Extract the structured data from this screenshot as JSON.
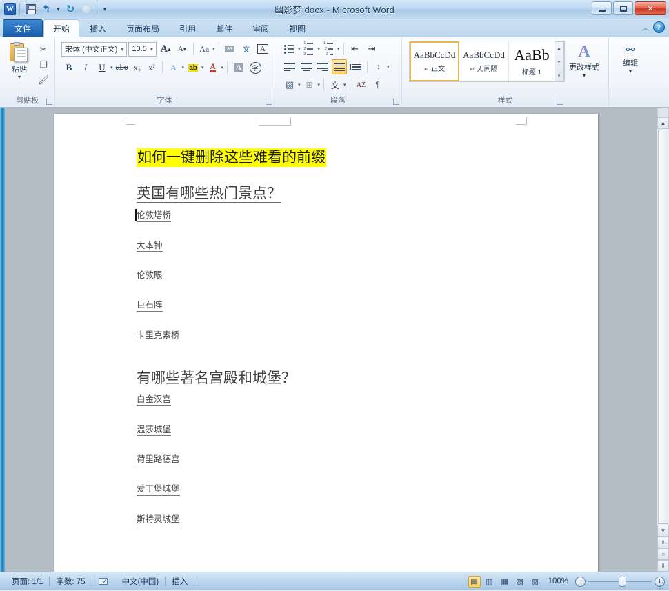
{
  "window": {
    "title": "幽影梦.docx - Microsoft Word",
    "minimize_label": "最小化",
    "restore_label": "还原",
    "close_label": "✕"
  },
  "quick_access": {
    "app_logo": "W",
    "items": [
      {
        "name": "save-icon",
        "label": "保存"
      },
      {
        "name": "undo-icon",
        "label": "撤消"
      },
      {
        "name": "undo-dropdown-icon",
        "label": "▾"
      },
      {
        "name": "redo-icon",
        "label": "恢复"
      },
      {
        "name": "print-preview-icon",
        "label": "打印预览"
      },
      {
        "name": "customize-qat-icon",
        "label": "▾"
      }
    ]
  },
  "tabs": [
    {
      "id": "file",
      "label": "文件"
    },
    {
      "id": "home",
      "label": "开始"
    },
    {
      "id": "insert",
      "label": "插入"
    },
    {
      "id": "layout",
      "label": "页面布局"
    },
    {
      "id": "references",
      "label": "引用"
    },
    {
      "id": "mailings",
      "label": "邮件"
    },
    {
      "id": "review",
      "label": "审阅"
    },
    {
      "id": "view",
      "label": "视图"
    }
  ],
  "ribbon_right": {
    "collapse_label": "︿",
    "help_label": "?"
  },
  "groups": {
    "clipboard": {
      "label": "剪贴板",
      "paste_label": "粘贴",
      "paste_caret": "▾",
      "cut_label": "✂",
      "copy_label": "❐",
      "format_painter_label": "🖌"
    },
    "font": {
      "label": "字体",
      "font_name": "宋体 (中文正文)",
      "font_size": "10.5",
      "grow_font": "A",
      "shrink_font": "A",
      "change_case": "Aa",
      "phonetic_guide": "Aa",
      "character_border": "文",
      "clear_formatting": "A",
      "bold": "B",
      "italic": "I",
      "underline": "U",
      "strikethrough": "abc",
      "subscript": "x₂",
      "superscript": "x²",
      "text_effects": "A",
      "highlight": "ab",
      "font_color": "A",
      "shading": "A",
      "enclose_char": "字",
      "dropdown": "▾"
    },
    "paragraph": {
      "label": "段落",
      "bullets": "•",
      "numbering": "1.",
      "multilevel": "⁝",
      "decrease_indent": "⇤",
      "increase_indent": "⇥",
      "align_left": "≡",
      "align_center": "≡",
      "align_right": "≡",
      "justify": "≡",
      "distributed": "≣",
      "line_spacing": "↕",
      "shading": "▨",
      "borders": "⊞",
      "asian_layout": "文",
      "sort": "AZ",
      "show_marks": "¶",
      "dropdown": "▾"
    },
    "styles": {
      "label": "样式",
      "items": [
        {
          "sample": "AaBbCcDd",
          "name": "正文",
          "pilcrow": "↵",
          "selected": true
        },
        {
          "sample": "AaBbCcDd",
          "name": "无间隔",
          "pilcrow": "↵",
          "selected": false
        },
        {
          "sample": "AaBb",
          "name": "标题 1",
          "pilcrow": "",
          "selected": false
        }
      ],
      "scroll_up": "▲",
      "scroll_down": "▼",
      "more": "▾",
      "change_styles_label": "更改样式",
      "change_styles_caret": "▾"
    },
    "editing": {
      "label": "编辑",
      "button_label": "编辑",
      "caret": "▾",
      "icon": "🔍"
    }
  },
  "document": {
    "title": "如何一键删除这些难看的前缀",
    "title_highlight_color": "#ffff00",
    "sections": [
      {
        "heading": "英国有哪些热门景点？",
        "heading_underlined": true,
        "items": [
          "伦敦塔桥",
          "大本钟",
          "伦敦眼",
          "巨石阵",
          "卡里克索桥"
        ]
      },
      {
        "heading": "有哪些著名宫殿和城堡？",
        "heading_underlined": false,
        "items": [
          "白金汉宫",
          "温莎城堡",
          "荷里路德宫",
          "爱丁堡城堡",
          "斯特灵城堡"
        ]
      }
    ]
  },
  "scrollbar": {
    "up_arrow": "▲",
    "down_arrow": "▼",
    "prev_page": "⬆",
    "select_browse_object": "○",
    "next_page": "⬇",
    "split_handle": "▭"
  },
  "statusbar": {
    "page_info": "页面: 1/1",
    "word_count": "字数: 75",
    "proofing_label": "校对",
    "language": "中文(中国)",
    "insert_mode": "插入",
    "zoom_level": "100%",
    "zoom_out": "−",
    "zoom_in": "+",
    "view_buttons": [
      {
        "name": "print-layout-view",
        "glyph": "▤",
        "selected": true
      },
      {
        "name": "full-screen-reading-view",
        "glyph": "▥",
        "selected": false
      },
      {
        "name": "web-layout-view",
        "glyph": "▦",
        "selected": false
      },
      {
        "name": "outline-view",
        "glyph": "▧",
        "selected": false
      },
      {
        "name": "draft-view",
        "glyph": "▨",
        "selected": false
      }
    ]
  }
}
